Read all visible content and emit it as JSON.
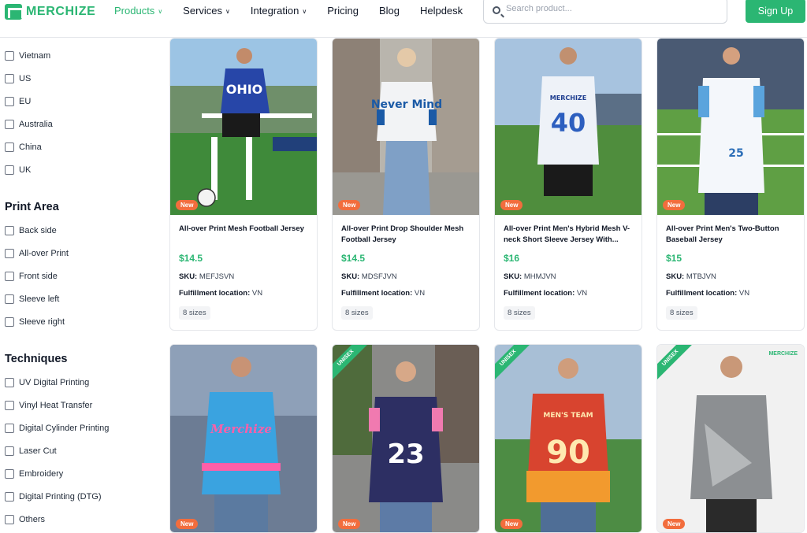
{
  "brand": {
    "name": "MERCHIZE"
  },
  "nav": [
    {
      "label": "Products",
      "dropdown": true,
      "active": true
    },
    {
      "label": "Services",
      "dropdown": true,
      "active": false
    },
    {
      "label": "Integration",
      "dropdown": true,
      "active": false
    },
    {
      "label": "Pricing",
      "dropdown": false,
      "active": false
    },
    {
      "label": "Blog",
      "dropdown": false,
      "active": false
    },
    {
      "label": "Helpdesk",
      "dropdown": false,
      "active": false
    }
  ],
  "search": {
    "placeholder": "Search product..."
  },
  "signup_label": "Sign Up",
  "filters": {
    "locations": [
      "Vietnam",
      "US",
      "EU",
      "Australia",
      "China",
      "UK"
    ],
    "print_area": {
      "title": "Print Area",
      "items": [
        "Back side",
        "All-over Print",
        "Front side",
        "Sleeve left",
        "Sleeve right"
      ]
    },
    "techniques": {
      "title": "Techniques",
      "items": [
        "UV Digital Printing",
        "Vinyl Heat Transfer",
        "Digital Cylinder Printing",
        "Laser Cut",
        "Embroidery",
        "Digital Printing (DTG)",
        "Others"
      ]
    }
  },
  "labels": {
    "sku": "SKU:",
    "fulfillment": "Fulfillment location:",
    "new_badge": "New",
    "unisex_badge": "UNISEX"
  },
  "products": [
    {
      "title": "All-over Print Mesh Football Jersey",
      "price": "$14.5",
      "sku": "MEFJSVN",
      "location": "VN",
      "sizes": "8 sizes"
    },
    {
      "title": "All-over Print Drop Shoulder Mesh Football Jersey",
      "price": "$14.5",
      "sku": "MDSFJVN",
      "location": "VN",
      "sizes": "8 sizes"
    },
    {
      "title": "All-over Print Men's Hybrid Mesh V-neck Short Sleeve Jersey With...",
      "price": "$16",
      "sku": "MHMJVN",
      "location": "VN",
      "sizes": "8 sizes"
    },
    {
      "title": "All-over Print Men's Two-Button Baseball Jersey",
      "price": "$15",
      "sku": "MTBJVN",
      "location": "VN",
      "sizes": "8 sizes"
    }
  ],
  "image_text": {
    "p1": "OHIO",
    "p2": "Never Mind",
    "p3_top": "MERCHIZE",
    "p3_num": "40",
    "p4_num": "25",
    "p5": "Merchize",
    "p6": "23",
    "p7_top": "MEN'S TEAM",
    "p7_num": "90",
    "p8_brand": "MERCHIZE"
  },
  "colors": {
    "accent": "#2bb673",
    "new_badge": "#f26d3d"
  }
}
